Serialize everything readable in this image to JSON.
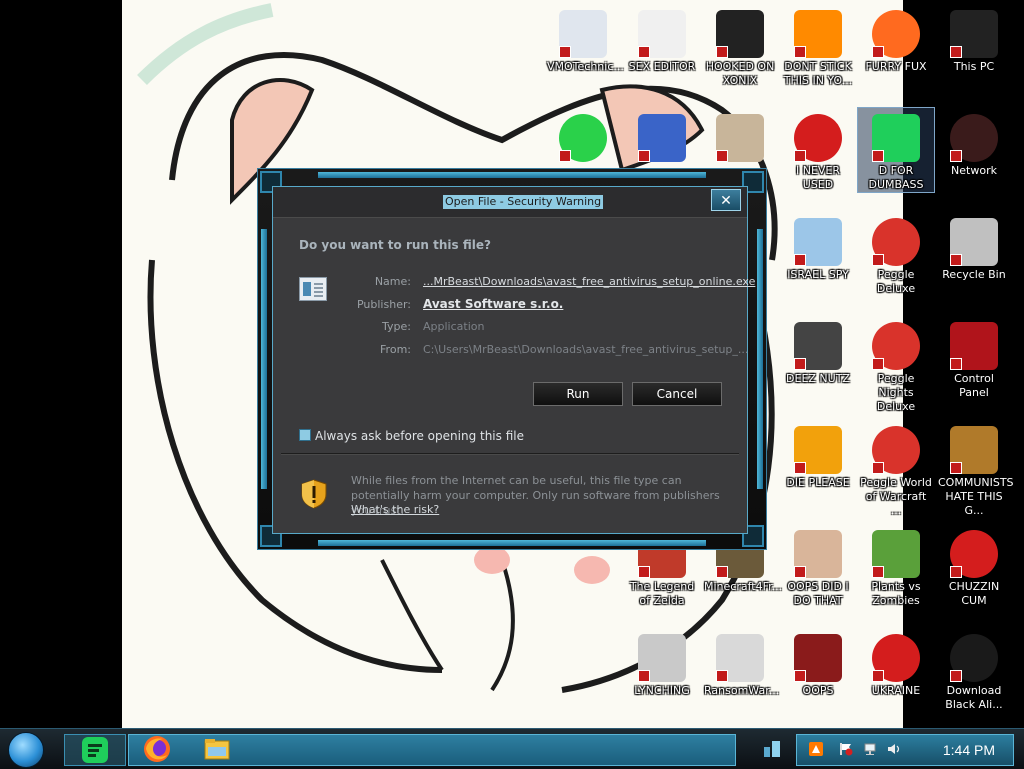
{
  "dialog": {
    "title": "Open File - Security Warning",
    "close_glyph": "✕",
    "question": "Do you want to run this file?",
    "fields": [
      {
        "label": "Name:",
        "value": "...MrBeast\\Downloads\\avast_free_antivirus_setup_online.exe"
      },
      {
        "label": "Publisher:",
        "value": "Avast Software s.r.o."
      },
      {
        "label": "Type:",
        "value": "Application"
      },
      {
        "label": "From:",
        "value": "C:\\Users\\MrBeast\\Downloads\\avast_free_antivirus_setup_..."
      }
    ],
    "run_label": "Run",
    "cancel_label": "Cancel",
    "checkbox_label": "Always ask before opening this file",
    "checkbox_checked": true,
    "warning_text": "While files from the Internet can be useful, this file type can potentially harm your computer. Only run software from publishers you trust.",
    "risk_link": "What's the risk?"
  },
  "desktop_icons": [
    {
      "label": "VMOTechnic...",
      "icon": "doctor-icon"
    },
    {
      "label": "SEX EDITOR",
      "icon": "hxd-icon"
    },
    {
      "label": "HOOKED ON XONIX",
      "icon": "game-icon"
    },
    {
      "label": "DONT STICK THIS IN YO...",
      "icon": "vlc-cone-icon"
    },
    {
      "label": "FURRY FUX",
      "icon": "firefox-icon"
    },
    {
      "label": "This PC",
      "icon": "computer-icon"
    },
    {
      "label": "",
      "icon": "lime-icon"
    },
    {
      "label": "",
      "icon": "card-icon"
    },
    {
      "label": "",
      "icon": "gnome-icon"
    },
    {
      "label": "I NEVER USED",
      "icon": "devcpp-icon"
    },
    {
      "label": "D FOR DUMBASS",
      "icon": "green-chat-icon"
    },
    {
      "label": "Network",
      "icon": "network-icon"
    },
    {
      "label": "ISRAEL SPY",
      "icon": "network-computers-icon"
    },
    {
      "label": "Peggle Deluxe",
      "icon": "peggle-icon"
    },
    {
      "label": "Recycle Bin",
      "icon": "recycle-bin-icon"
    },
    {
      "label": "DEEZ NUTZ",
      "icon": "stack-icon"
    },
    {
      "label": "Peggle Nights Deluxe",
      "icon": "peggle-nights-icon"
    },
    {
      "label": "Control Panel",
      "icon": "control-panel-icon"
    },
    {
      "label": "DIE PLEASE",
      "icon": "de-icon"
    },
    {
      "label": "Peggle World of Warcraft ...",
      "icon": "peggle-wow-icon"
    },
    {
      "label": "COMMUNISTS HATE THIS G...",
      "icon": "money-bag-icon"
    },
    {
      "label": "The Legend of Zelda",
      "icon": "zelda-icon"
    },
    {
      "label": "Minecraft4Fr...",
      "icon": "minecraft-icon"
    },
    {
      "label": "OOPS DID I DO THAT",
      "icon": "portrait-icon"
    },
    {
      "label": "Plants vs Zombies",
      "icon": "pvz-icon"
    },
    {
      "label": "CHUZZIN CUM",
      "icon": "chuzzle-icon"
    },
    {
      "label": "LYNCHING",
      "icon": "noose-icon"
    },
    {
      "label": "RansomWar...",
      "icon": "skull-icon"
    },
    {
      "label": "OOPS",
      "icon": "red-box-icon"
    },
    {
      "label": "UKRAINE",
      "icon": "radiation-icon"
    },
    {
      "label": "Download Black Ali...",
      "icon": "black-orb-icon"
    }
  ],
  "taskbar": {
    "clock": "1:44 PM",
    "pinned": [
      "green-chat-icon",
      "firefox-icon",
      "file-explorer-icon"
    ]
  },
  "colors": {
    "accent": "#4fb7d8",
    "dialog_bg": "#3a3a3c",
    "title_highlight": "#8ecbe3"
  }
}
